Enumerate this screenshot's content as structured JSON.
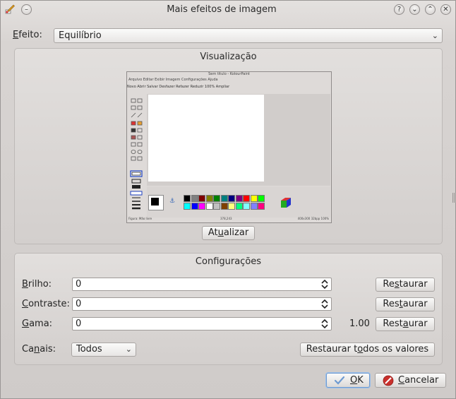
{
  "window": {
    "title": "Mais efeitos de imagem"
  },
  "effect": {
    "label_prefix": "E",
    "label_rest": "feito:",
    "selected": "Equilíbrio"
  },
  "preview": {
    "title": "Visualização",
    "update_button": {
      "before": "At",
      "mnemonic": "u",
      "after": "alizar"
    },
    "thumbnail": {
      "window_title": "Sem título - KolourPaint",
      "menu": "Arquivo Editar Exibir Imagem Configurações Ajuda",
      "toolbar": "Novo  Abrir  Salvar     Desfazer     Refazer   Reduzir   100%   Ampliar",
      "status_left": "Figura: Mão livre",
      "status_mid": "378,243",
      "status_right": "400x300   32bpp   100%",
      "palette": [
        "#000000",
        "#808080",
        "#800000",
        "#808000",
        "#008000",
        "#008080",
        "#000080",
        "#800080",
        "#ff0000",
        "#ffff00",
        "#00ff00",
        "#00ffff",
        "#0000ff",
        "#ff00ff",
        "#ffffff",
        "#c0c0c0",
        "#804000",
        "#ffff80",
        "#00ff80",
        "#80ffff",
        "#8080ff",
        "#ff0080"
      ]
    }
  },
  "settings": {
    "title": "Configurações",
    "rows": [
      {
        "label_mn": "B",
        "label_rest": "rilho:",
        "value": "0",
        "extra": "",
        "reset_before": "Re",
        "reset_mn": "s",
        "reset_after": "taurar"
      },
      {
        "label_mn": "C",
        "label_rest": "ontraste:",
        "value": "0",
        "extra": "",
        "reset_before": "Res",
        "reset_mn": "t",
        "reset_after": "aurar"
      },
      {
        "label_mn": "G",
        "label_rest": "ama:",
        "value": "0",
        "extra": "1.00",
        "reset_before": "Rest",
        "reset_mn": "a",
        "reset_after": "urar"
      }
    ],
    "channels": {
      "label_before": "Ca",
      "label_mn": "n",
      "label_after": "ais:",
      "selected": "Todos"
    },
    "reset_all": {
      "before": "Restaurar t",
      "mn": "o",
      "after": "dos os valores"
    }
  },
  "footer": {
    "ok": {
      "mn": "O",
      "rest": "K"
    },
    "cancel": {
      "mn": "C",
      "rest": "ancelar"
    }
  },
  "colors": {
    "accent": "#6f9bd1",
    "cancel_icon": "#c9302c"
  }
}
